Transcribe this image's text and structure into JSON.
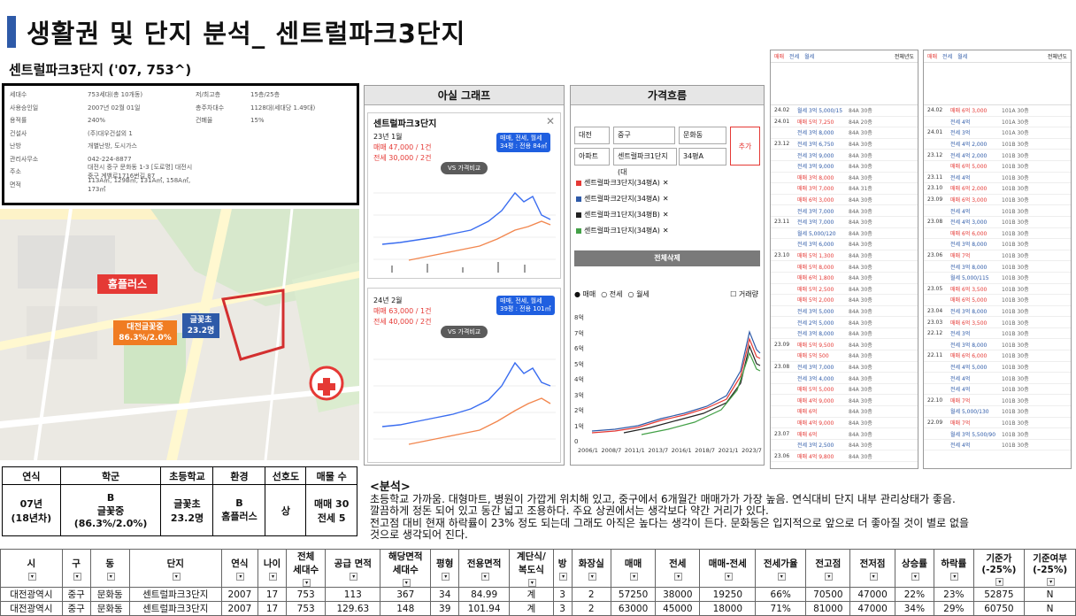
{
  "title": "생활권 및 단지 분석_ 센트럴파크3단지",
  "subtitle": "센트럴파크3단지 ('07, 753^)",
  "info": {
    "rows": [
      {
        "k": "세대수",
        "v": "753세대(총 10개동)",
        "k2": "저/최고층",
        "v2": "15층/25층"
      },
      {
        "k": "사용승인일",
        "v": "2007년 02월 01일",
        "k2": "총주차대수",
        "v2": "1128대(세대당 1.49대)"
      },
      {
        "k": "용적률",
        "v": "240%",
        "k2": "건폐율",
        "v2": "15%"
      },
      {
        "k": "건설사",
        "v": "(주)대우건설외 1",
        "k2": "",
        "v2": ""
      },
      {
        "k": "난방",
        "v": "개별난방, 도시가스",
        "k2": "",
        "v2": ""
      },
      {
        "k": "관리사무소",
        "v": "042-224-8877",
        "k2": "",
        "v2": ""
      },
      {
        "k": "주소",
        "v": "대전시 중구 문화동 1-3 [도로명] 대전시 중구 계백로1716번길 87",
        "k2": "",
        "v2": ""
      },
      {
        "k": "면적",
        "v": "113A㎡, 129B㎡, 131A㎡, 158A㎡, 173㎡",
        "k2": "",
        "v2": ""
      }
    ]
  },
  "map": {
    "homeplus": "홈플러스",
    "school1": "대전글꽃중",
    "school1_rate": "86.3%/2.0%",
    "school2": "글꽃초",
    "school2_count": "23.2명"
  },
  "apsil": {
    "header": "아실 그래프",
    "card1": {
      "name": "센트럴파크3단지",
      "date": "23년 1월",
      "sale": "매매 47,000 / 1건",
      "rent": "전세 30,000 / 2건",
      "pill1": "매매, 전세, 월세",
      "pill2": "34평 : 전용 84㎡",
      "vs": "VS 가격비교"
    },
    "card2": {
      "date": "24년 2월",
      "sale": "매매 63,000 / 1건",
      "rent": "전세 40,000 / 2건",
      "pill1": "매매, 전세, 월세",
      "pill2": "39평 : 전용 101㎡",
      "vs": "VS 가격비교"
    }
  },
  "flow": {
    "header": "가격흐름",
    "sel1": "대전",
    "sel2": "중구",
    "sel3": "문화동",
    "sel4": "아파트",
    "sel5": "센트럴파크1단지(대",
    "sel6": "34평A",
    "add": "추가",
    "legends": [
      "센트럴파크3단지(34평A)",
      "센트럴파크2단지(34평A)",
      "센트럴파크1단지(34평B)",
      "센트럴파크1단지(34평A)"
    ],
    "clear": "전체삭제",
    "radio1": "매매",
    "radio2": "전세",
    "radio3": "월세",
    "volume": "거래량",
    "ylabels": [
      "8억",
      "7억",
      "6억",
      "5억",
      "4억",
      "3억",
      "2억",
      "1억",
      "0"
    ],
    "xlabels": [
      "2006/1",
      "2008/7",
      "2011/1",
      "2013/7",
      "2016/1",
      "2018/7",
      "2021/1",
      "2023/7"
    ]
  },
  "list1": {
    "tabs": [
      "매매",
      "전세",
      "월세"
    ],
    "year": "전체년도",
    "rows": [
      {
        "d": "24.02",
        "p": "월세 3억 5,000/15",
        "e": "84A 30층"
      },
      {
        "d": "24.01",
        "p": "매매 5억 7,250",
        "e": "84A 20층"
      },
      {
        "d": "",
        "p": "전세 3억 8,000",
        "e": "84A 30층"
      },
      {
        "d": "23.12",
        "p": "전세 3억 6,750",
        "e": "84A 30층"
      },
      {
        "d": "",
        "p": "전세 3억 9,000",
        "e": "84A 30층"
      },
      {
        "d": "",
        "p": "전세 3억 9,000",
        "e": "84A 30층"
      },
      {
        "d": "",
        "p": "매매 3억 8,000",
        "e": "84A 30층"
      },
      {
        "d": "",
        "p": "매매 3억 7,000",
        "e": "84A 31층"
      },
      {
        "d": "",
        "p": "매매 6억 3,000",
        "e": "84A 30층"
      },
      {
        "d": "",
        "p": "전세 3억 7,000",
        "e": "84A 30층"
      },
      {
        "d": "23.11",
        "p": "전세 3억 7,000",
        "e": "84A 30층"
      },
      {
        "d": "",
        "p": "월세 5,000/120",
        "e": "84A 30층"
      },
      {
        "d": "",
        "p": "전세 3억 6,000",
        "e": "84A 30층"
      },
      {
        "d": "23.10",
        "p": "매매 5억 1,300",
        "e": "84A 30층"
      },
      {
        "d": "",
        "p": "매매 5억 8,000",
        "e": "84A 30층"
      },
      {
        "d": "",
        "p": "매매 6억 1,800",
        "e": "84A 30층"
      },
      {
        "d": "",
        "p": "매매 5억 2,500",
        "e": "84A 30층"
      },
      {
        "d": "",
        "p": "매매 5억 2,000",
        "e": "84A 30층"
      },
      {
        "d": "",
        "p": "전세 3억 5,000",
        "e": "84A 30층"
      },
      {
        "d": "",
        "p": "전세 2억 5,000",
        "e": "84A 30층"
      },
      {
        "d": "",
        "p": "전세 3억 8,000",
        "e": "84A 30층"
      },
      {
        "d": "23.09",
        "p": "매매 5억 9,500",
        "e": "84A 30층"
      },
      {
        "d": "",
        "p": "매매 5억 500",
        "e": "84A 30층"
      },
      {
        "d": "23.08",
        "p": "전세 3억 7,000",
        "e": "84A 30층"
      },
      {
        "d": "",
        "p": "전세 3억 4,000",
        "e": "84A 30층"
      },
      {
        "d": "",
        "p": "매매 5억 5,000",
        "e": "84A 30층"
      },
      {
        "d": "",
        "p": "매매 4억 9,000",
        "e": "84A 30층"
      },
      {
        "d": "",
        "p": "매매 6억",
        "e": "84A 30층"
      },
      {
        "d": "",
        "p": "매매 4억 9,000",
        "e": "84A 30층"
      },
      {
        "d": "23.07",
        "p": "매매 6억",
        "e": "84A 30층"
      },
      {
        "d": "",
        "p": "전세 3억 2,500",
        "e": "84A 30층"
      },
      {
        "d": "23.06",
        "p": "매매 4억 9,800",
        "e": "84A 30층"
      }
    ]
  },
  "list2": {
    "tabs": [
      "매매",
      "전세",
      "월세"
    ],
    "year": "전체년도",
    "rows": [
      {
        "d": "24.02",
        "p": "매매 6억 3,000",
        "e": "101A 30층"
      },
      {
        "d": "",
        "p": "전세 4억",
        "e": "101A 30층"
      },
      {
        "d": "24.01",
        "p": "전세 3억",
        "e": "101A 30층"
      },
      {
        "d": "",
        "p": "전세 4억 2,000",
        "e": "101B 30층"
      },
      {
        "d": "23.12",
        "p": "전세 4억 2,000",
        "e": "101B 30층"
      },
      {
        "d": "",
        "p": "매매 6억 5,000",
        "e": "101B 30층"
      },
      {
        "d": "23.11",
        "p": "전세 4억",
        "e": "101B 30층"
      },
      {
        "d": "23.10",
        "p": "매매 6억 2,000",
        "e": "101B 30층"
      },
      {
        "d": "23.09",
        "p": "매매 6억 3,000",
        "e": "101B 30층"
      },
      {
        "d": "",
        "p": "전세 4억",
        "e": "101B 30층"
      },
      {
        "d": "23.08",
        "p": "전세 4억 3,000",
        "e": "101B 30층"
      },
      {
        "d": "",
        "p": "매매 6억 6,000",
        "e": "101B 30층"
      },
      {
        "d": "",
        "p": "전세 3억 8,000",
        "e": "101B 30층"
      },
      {
        "d": "23.06",
        "p": "매매 7억",
        "e": "101B 30층"
      },
      {
        "d": "",
        "p": "전세 3억 8,000",
        "e": "101B 30층"
      },
      {
        "d": "",
        "p": "월세 5,000/115",
        "e": "101B 30층"
      },
      {
        "d": "23.05",
        "p": "매매 6억 3,500",
        "e": "101B 30층"
      },
      {
        "d": "",
        "p": "매매 6억 5,000",
        "e": "101B 30층"
      },
      {
        "d": "23.04",
        "p": "전세 3억 8,000",
        "e": "101B 30층"
      },
      {
        "d": "23.03",
        "p": "매매 6억 3,500",
        "e": "101B 30층"
      },
      {
        "d": "22.12",
        "p": "전세 3억",
        "e": "101B 30층"
      },
      {
        "d": "",
        "p": "전세 3억 8,000",
        "e": "101B 30층"
      },
      {
        "d": "22.11",
        "p": "매매 6억 6,000",
        "e": "101B 30층"
      },
      {
        "d": "",
        "p": "전세 4억 5,000",
        "e": "101B 30층"
      },
      {
        "d": "",
        "p": "전세 4억",
        "e": "101B 30층"
      },
      {
        "d": "",
        "p": "전세 4억",
        "e": "101B 30층"
      },
      {
        "d": "22.10",
        "p": "매매 7억",
        "e": "101B 30층"
      },
      {
        "d": "",
        "p": "월세 5,000/130",
        "e": "101B 30층"
      },
      {
        "d": "22.09",
        "p": "매매 7억",
        "e": "101B 30층"
      },
      {
        "d": "",
        "p": "월세 3억 5,500/90",
        "e": "101B 30층"
      },
      {
        "d": "",
        "p": "전세 4억",
        "e": "101B 30층"
      }
    ]
  },
  "summary": {
    "headers": [
      "연식",
      "학군",
      "초등학교",
      "환경",
      "선호도",
      "매물 수"
    ],
    "values": [
      "07년\n(18년차)",
      "B\n글꽃중\n(86.3%/2.0%)",
      "글꽃초\n23.2명",
      "B\n홈플러스",
      "상",
      "매매 30\n전세 5"
    ]
  },
  "analysis": {
    "heading": "<분석>",
    "lines": [
      "초등학교 가까움. 대형마트, 병원이 가깝게 위치해 있고, 중구에서 6개월간 매매가가 가장 높음. 연식대비 단지 내부 관리상태가 좋음.",
      "깔끔하게 정돈 되어 있고 동간 넓고 조용하다. 주요 상권에서는 생각보다 약간 거리가 있다.",
      "전고점 대비 현재 하락률이 23% 정도 되는데 그래도 아직은 높다는 생각이 든다. 문화동은 입지적으로 앞으로 더 좋아질 것이 별로 없을",
      "것으로 생각되어 진다."
    ]
  },
  "table": {
    "headers": [
      "시",
      "구",
      "동",
      "단지",
      "연식",
      "나이",
      "전체\n세대수",
      "공급 면적",
      "해당면적\n세대수",
      "평형",
      "전용면적",
      "계단식/\n복도식",
      "방",
      "화장실",
      "매매",
      "전세",
      "매매-전세",
      "전세가율",
      "전고점",
      "전저점",
      "상승률",
      "하락률",
      "기준가\n(-25%)",
      "기준여부\n(-25%)"
    ],
    "rows": [
      [
        "대전광역시",
        "중구",
        "문화동",
        "센트럴파크3단지",
        "2007",
        "17",
        "753",
        "113",
        "367",
        "34",
        "84.99",
        "계",
        "3",
        "2",
        "57250",
        "38000",
        "19250",
        "66%",
        "70500",
        "47000",
        "22%",
        "23%",
        "52875",
        "N"
      ],
      [
        "대전광역시",
        "중구",
        "문화동",
        "센트럴파크3단지",
        "2007",
        "17",
        "753",
        "129.63",
        "148",
        "39",
        "101.94",
        "계",
        "3",
        "2",
        "63000",
        "45000",
        "18000",
        "71%",
        "81000",
        "47000",
        "34%",
        "29%",
        "60750",
        "N"
      ]
    ]
  }
}
